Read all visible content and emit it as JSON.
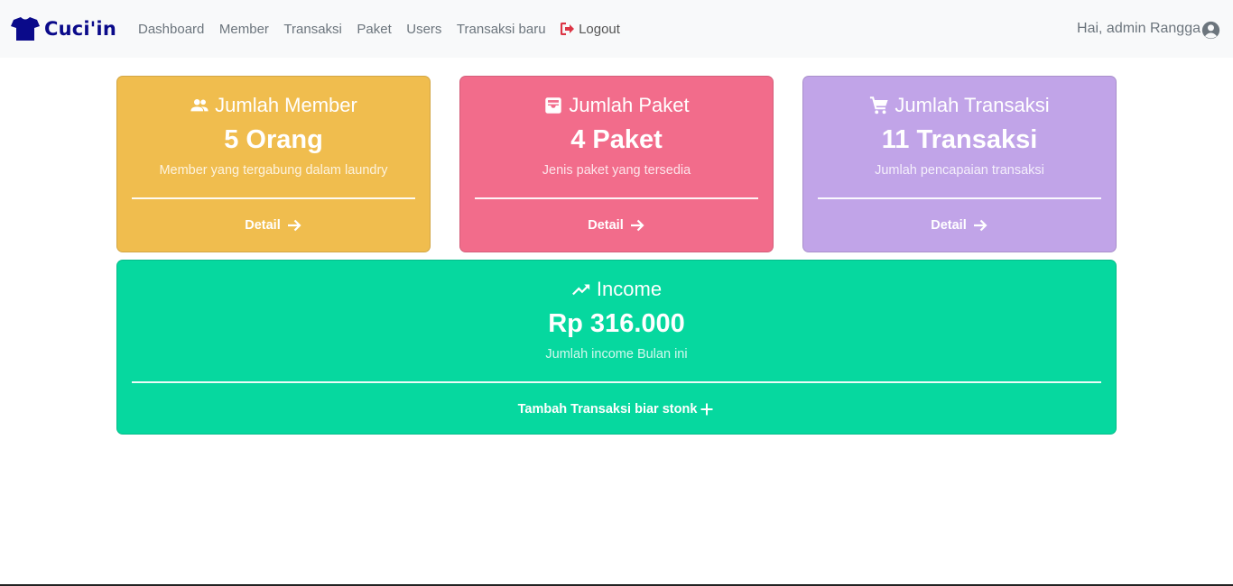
{
  "brand": {
    "name": "Cuci'in",
    "icon": "tshirt-icon",
    "color": "#0a0a8a"
  },
  "nav": {
    "links": [
      "Dashboard",
      "Member",
      "Transaksi",
      "Paket",
      "Users",
      "Transaksi baru"
    ],
    "logout": {
      "label": "Logout",
      "icon": "sign-out-icon",
      "icon_color": "#dc3545"
    },
    "user_greeting": "Hai, admin Rangga",
    "user_icon": "user-circle-icon"
  },
  "cards": {
    "member": {
      "title": "Jumlah Member",
      "icon": "users-icon",
      "value": "5 Orang",
      "subtitle": "Member yang tergabung dalam laundry",
      "link": "Detail",
      "color": "#f0bd4e"
    },
    "paket": {
      "title": "Jumlah Paket",
      "icon": "inbox-icon",
      "value": "4 Paket",
      "subtitle": "Jenis paket yang tersedia",
      "link": "Detail",
      "color": "#f26c8b"
    },
    "transaksi": {
      "title": "Jumlah Transaksi",
      "icon": "cart-icon",
      "value": "11 Transaksi",
      "subtitle": "Jumlah pencapaian transaksi",
      "link": "Detail",
      "color": "#c1a4e8"
    },
    "income": {
      "title": "Income",
      "icon": "trending-up-icon",
      "value": "Rp 316.000",
      "subtitle": "Jumlah income Bulan ini",
      "link": "Tambah Transaksi biar stonk",
      "link_icon": "plus-icon",
      "color": "#06d89f"
    }
  }
}
